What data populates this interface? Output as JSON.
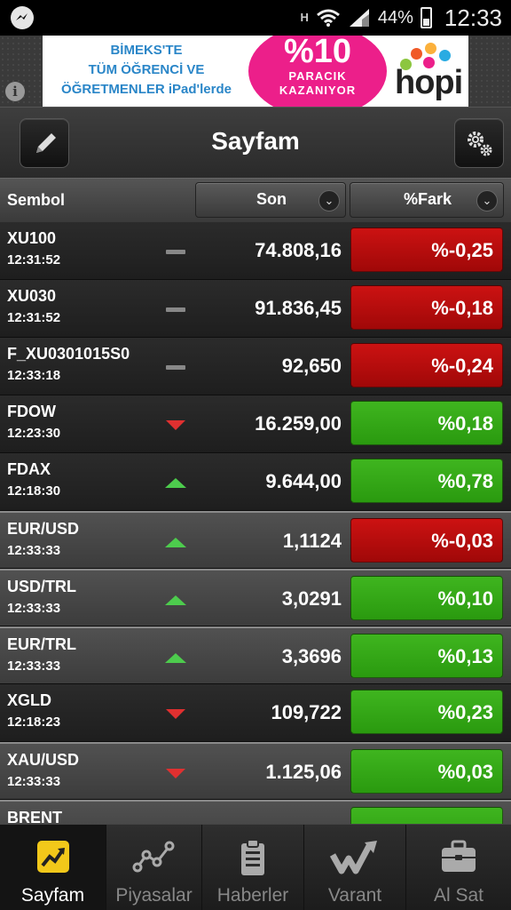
{
  "status_bar": {
    "network": "H",
    "battery": "44%",
    "time": "12:33",
    "icons": [
      "messenger-icon",
      "wifi-icon",
      "signal-icon",
      "battery-icon"
    ]
  },
  "ad": {
    "text_lines": [
      "BİMEKS'TE",
      "TÜM ÖĞRENCİ VE",
      "ÖĞRETMENLER iPad'lerde"
    ],
    "highlight_big": "%10",
    "highlight_small_1": "PARACIK",
    "highlight_small_2": "KAZANIYOR",
    "brand": "hopi",
    "brand_dot_colors": [
      "#f05a28",
      "#8cc63f",
      "#29abe2",
      "#ec1f8a",
      "#fbb03b"
    ],
    "info": "i"
  },
  "header": {
    "title": "Sayfam",
    "left_icon": "pencil-icon",
    "right_icon": "gears-icon"
  },
  "columns": {
    "symbol": "Sembol",
    "last": "Son",
    "change": "%Fark"
  },
  "rows": [
    {
      "symbol": "XU100",
      "time": "12:31:52",
      "trend": "flat",
      "value": "74.808,16",
      "change": "%-0,25",
      "dir": "neg",
      "style": "dark"
    },
    {
      "symbol": "XU030",
      "time": "12:31:52",
      "trend": "flat",
      "value": "91.836,45",
      "change": "%-0,18",
      "dir": "neg",
      "style": "dark"
    },
    {
      "symbol": "F_XU0301015S0",
      "time": "12:33:18",
      "trend": "flat",
      "value": "92,650",
      "change": "%-0,24",
      "dir": "neg",
      "style": "dark"
    },
    {
      "symbol": "FDOW",
      "time": "12:23:30",
      "trend": "down",
      "value": "16.259,00",
      "change": "%0,18",
      "dir": "pos",
      "style": "dark"
    },
    {
      "symbol": "FDAX",
      "time": "12:18:30",
      "trend": "up",
      "value": "9.644,00",
      "change": "%0,78",
      "dir": "pos",
      "style": "dark"
    },
    {
      "symbol": "EUR/USD",
      "time": "12:33:33",
      "trend": "up",
      "value": "1,1124",
      "change": "%-0,03",
      "dir": "neg",
      "style": "light"
    },
    {
      "symbol": "USD/TRL",
      "time": "12:33:33",
      "trend": "up",
      "value": "3,0291",
      "change": "%0,10",
      "dir": "pos",
      "style": "light"
    },
    {
      "symbol": "EUR/TRL",
      "time": "12:33:33",
      "trend": "up",
      "value": "3,3696",
      "change": "%0,13",
      "dir": "pos",
      "style": "light"
    },
    {
      "symbol": "XGLD",
      "time": "12:18:23",
      "trend": "down",
      "value": "109,722",
      "change": "%0,23",
      "dir": "pos",
      "style": "dark"
    },
    {
      "symbol": "XAU/USD",
      "time": "12:33:33",
      "trend": "down",
      "value": "1.125,06",
      "change": "%0,03",
      "dir": "pos",
      "style": "light"
    },
    {
      "symbol": "BRENT",
      "time": "",
      "trend": "none",
      "value": "",
      "change": "",
      "dir": "pos",
      "style": "light"
    }
  ],
  "nav": [
    {
      "label": "Sayfam",
      "icon": "chart-trend-icon",
      "active": true
    },
    {
      "label": "Piyasalar",
      "icon": "line-graph-icon",
      "active": false
    },
    {
      "label": "Haberler",
      "icon": "news-clipboard-icon",
      "active": false
    },
    {
      "label": "Varant",
      "icon": "varant-w-icon",
      "active": false
    },
    {
      "label": "Al Sat",
      "icon": "briefcase-icon",
      "active": false
    }
  ],
  "colors": {
    "negative": "#b50d0d",
    "positive": "#34a816",
    "up_arrow": "#4dcc4d",
    "down_arrow": "#e03030",
    "active_nav_icon": "#f2c81a"
  }
}
